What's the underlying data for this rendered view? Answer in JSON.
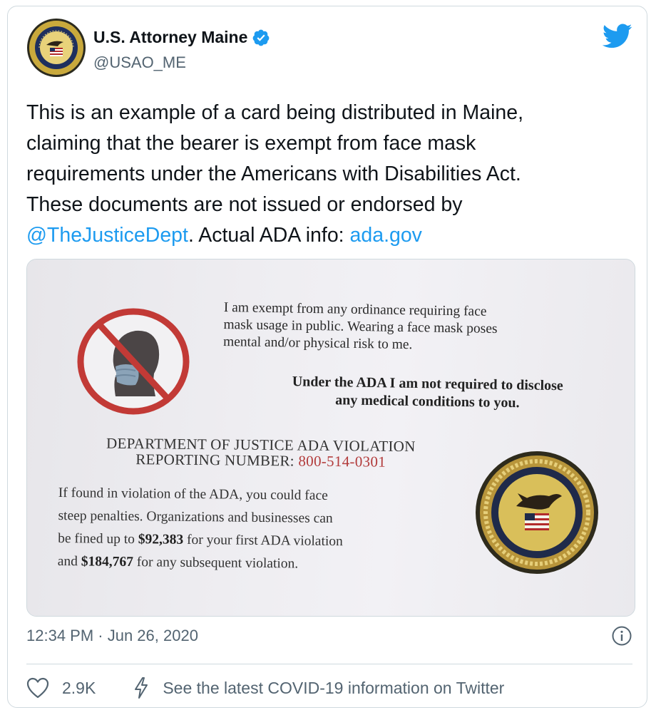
{
  "author": {
    "display_name": "U.S. Attorney Maine",
    "handle": "@USAO_ME",
    "avatar_icon": "doj-seal-icon",
    "verified_icon": "verified-badge-icon"
  },
  "brand_icon": "twitter-bird-icon",
  "colors": {
    "link": "#1d9bf0",
    "text": "#0f1419",
    "muted": "#536471",
    "border": "#cfd9de",
    "phone_red": "#b23a3a",
    "prohibition_red": "#c23a36"
  },
  "tweet": {
    "line1": "This is an example of a card being distributed in Maine,",
    "line2": "claiming that the bearer is exempt from face mask",
    "line3": "requirements under the Americans with Disabilities Act.",
    "line4": "These documents are not issued or endorsed by",
    "mention": "@TheJusticeDept",
    "line5_mid": ". Actual ADA info: ",
    "url": "ada.gov"
  },
  "card": {
    "exempt_lines": [
      "I am exempt from any ordinance requiring face",
      "mask usage in public. Wearing a face mask poses",
      "mental and/or physical risk to me."
    ],
    "ada_lines": [
      "Under the ADA I am not required to disclose",
      "any medical conditions to you."
    ],
    "doj_line1": "DEPARTMENT OF JUSTICE ADA VIOLATION",
    "doj_line2_label": "REPORTING NUMBER: ",
    "phone": "800-514-0301",
    "penalty_line1": "If found in violation of the ADA, you could face",
    "penalty_line2": "steep penalties. Organizations and businesses can",
    "penalty_line3_pre": "be fined up to ",
    "amount1": "$92,383",
    "penalty_line3_post": " for your first ADA violation",
    "penalty_line4_pre": "and ",
    "amount2": "$184,767",
    "penalty_line4_post": " for any subsequent violation.",
    "symbol_icon": "no-mask-prohibition-icon",
    "seal_icon": "doj-seal-icon"
  },
  "meta": {
    "timestamp": "12:34 PM · Jun 26, 2020",
    "info_icon": "info-icon"
  },
  "actions": {
    "like_count": "2.9K",
    "like_icon": "heart-icon",
    "covid_icon": "bolt-icon",
    "covid_label": "See the latest COVID-19 information on Twitter"
  }
}
